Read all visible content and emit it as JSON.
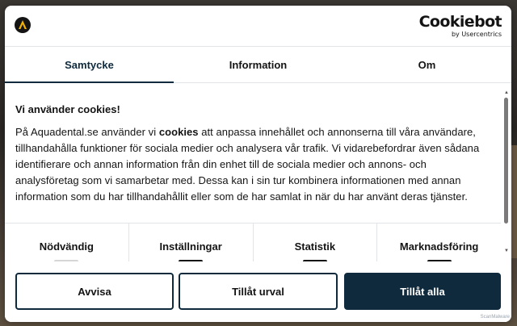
{
  "brand": {
    "name": "Cookiebot",
    "sub": "by Usercentrics"
  },
  "tabs": [
    {
      "label": "Samtycke",
      "active": true
    },
    {
      "label": "Information",
      "active": false
    },
    {
      "label": "Om",
      "active": false
    }
  ],
  "content": {
    "heading": "Vi använder cookies!",
    "text_before": "På Aquadental.se använder vi ",
    "text_bold": "cookies",
    "text_after": " att anpassa innehållet och annonserna till våra användare, tillhandahålla funktioner för sociala medier och analysera vår trafik. Vi vidarebefordrar även sådana identifierare och annan information från din enhet till de sociala medier och annons- och analysföretag som vi samarbetar med. Dessa kan i sin tur kombinera informationen med annan information som du har tillhandahållit eller som de har samlat in när du har använt deras tjänster."
  },
  "categories": [
    {
      "label": "Nödvändig",
      "enabled": false
    },
    {
      "label": "Inställningar",
      "enabled": true
    },
    {
      "label": "Statistik",
      "enabled": true
    },
    {
      "label": "Marknadsföring",
      "enabled": true
    }
  ],
  "buttons": {
    "reject": "Avvisa",
    "allow_selection": "Tillåt urval",
    "allow_all": "Tillåt alla"
  },
  "watermark": "ScanMalware",
  "colors": {
    "primary": "#0f2a3d",
    "logo_accent": "#f5b301"
  },
  "icons": {
    "site_logo": "aquadental-logo-icon",
    "scroll_up": "triangle-up",
    "scroll_down": "triangle-down"
  }
}
